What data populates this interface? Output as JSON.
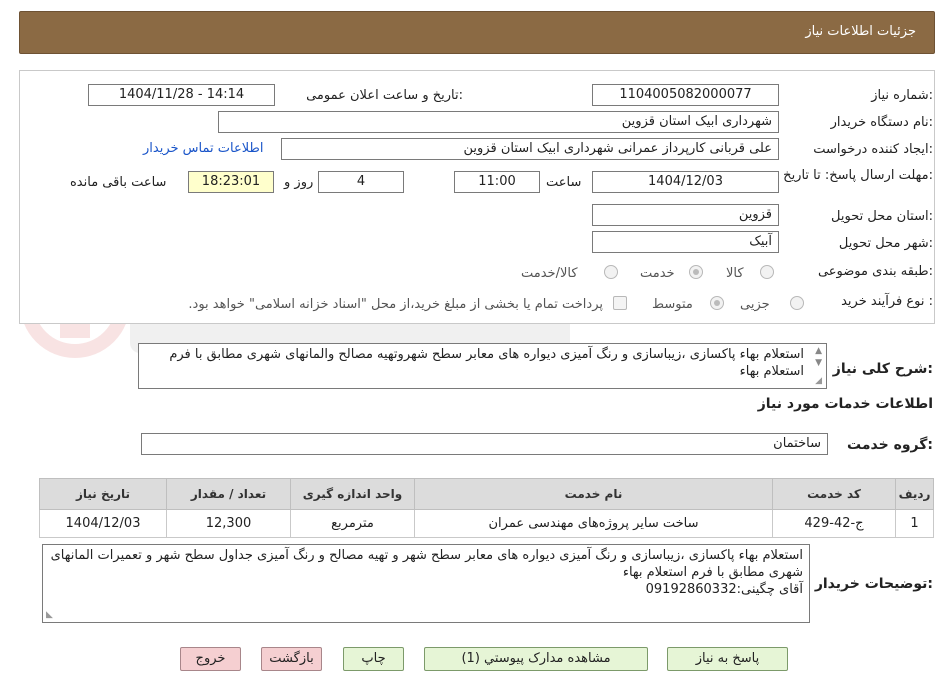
{
  "header": {
    "title": "جزئیات اطلاعات نیاز"
  },
  "form": {
    "need_number_label": "شماره نیاز:",
    "need_number": "1104005082000077",
    "announce_label": "تاریخ و ساعت اعلان عمومی:",
    "announce_value": "1404/11/28 - 14:14",
    "buyer_org_label": "نام دستگاه خریدار:",
    "buyer_org": "شهرداری ابیک استان قزوین",
    "creator_label": "ایجاد کننده درخواست:",
    "creator": "علی قربانی کارپرداز عمرانی شهرداری ابیک استان قزوین",
    "contact_link": "اطلاعات تماس خریدار",
    "deadline_label": "مهلت ارسال پاسخ: تا تاریخ:",
    "deadline_date": "1404/12/03",
    "time_label": "ساعت",
    "deadline_time": "11:00",
    "days_value": "4",
    "days_label": "روز و",
    "remaining_time": "18:23:01",
    "remaining_label": "ساعت باقی مانده",
    "province_label": "استان محل تحویل:",
    "province": "قزوین",
    "city_label": "شهر محل تحویل:",
    "city": "آبیک",
    "category_label": "طبقه بندی موضوعی:",
    "category_options": [
      "کالا",
      "خدمت",
      "کالا/خدمت"
    ],
    "process_label": "نوع فرآیند خرید :",
    "process_options": [
      "جزیی",
      "متوسط"
    ],
    "payment_note": "پرداخت تمام یا بخشی از مبلغ خرید،از محل \"اسناد خزانه اسلامی\" خواهد بود."
  },
  "summary": {
    "label": "شرح کلی نیاز:",
    "text": "استعلام بهاء پاکسازی ،زیباسازی و رنگ آمیزی دیواره های معابر سطح شهروتهیه مصالح والمانهای شهری مطابق با فرم استعلام بهاء"
  },
  "services": {
    "title": "اطلاعات خدمات مورد نیاز",
    "group_label": "گروه خدمت:",
    "group_value": "ساختمان",
    "columns": [
      "ردیف",
      "کد خدمت",
      "نام خدمت",
      "واحد اندازه گیری",
      "تعداد / مقدار",
      "تاریخ نیاز"
    ],
    "rows": [
      [
        "1",
        "ج-42-429",
        "ساخت سایر پروژه‌های مهندسی عمران",
        "مترمربع",
        "12,300",
        "1404/12/03"
      ]
    ]
  },
  "buyer_notes": {
    "label": "توضیحات خریدار:",
    "line1": "استعلام بهاء پاکسازی ،زیباسازی و رنگ آمیزی دیواره های معابر سطح شهر و تهیه مصالح و رنگ آمیزی جداول سطح شهر و تعمیرات المانهای شهری مطابق با فرم استعلام بهاء",
    "line2": "آقای چگینی:09192860332"
  },
  "buttons": {
    "reply": "پاسخ به نیاز",
    "attachments": "مشاهده مدارک پیوستي (1)",
    "print": "چاپ",
    "back": "بازگشت",
    "exit": "خروج"
  },
  "colors": {
    "header_bg": "#8b6a44",
    "link": "#1a55c9",
    "exit_bg": "#f5cfd1",
    "btn_green": "#e6f5d6"
  }
}
